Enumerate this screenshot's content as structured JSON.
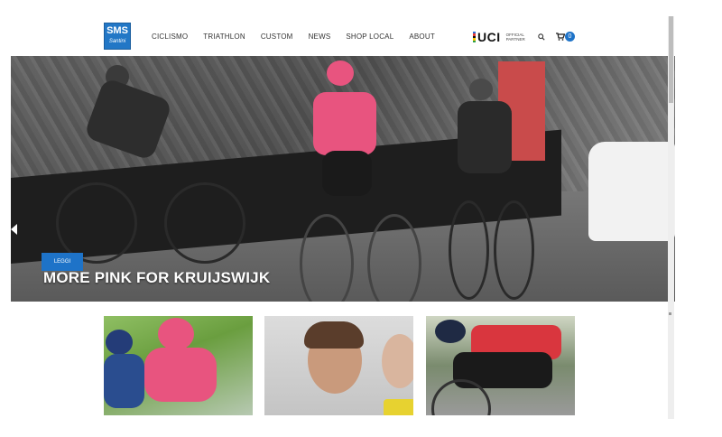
{
  "header": {
    "logo": {
      "main": "SMS",
      "sub": "Santini"
    },
    "nav": [
      "CICLISMO",
      "TRIATHLON",
      "CUSTOM",
      "NEWS",
      "SHOP LOCAL",
      "ABOUT"
    ],
    "uci": {
      "text": "UCI",
      "official": "OFFICIAL",
      "partner": "PARTNER"
    },
    "cart_count": "0"
  },
  "hero": {
    "read_label": "LEGGI",
    "title": "MORE PINK FOR KRUIJSWIJK"
  },
  "colors": {
    "accent": "#1e73c8",
    "pink_jersey": "#e8547f"
  }
}
